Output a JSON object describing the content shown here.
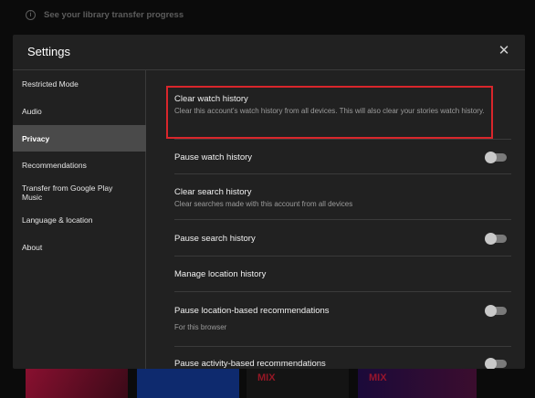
{
  "background": {
    "notice_icon": "info-icon",
    "notice_text": "See your library transfer progress",
    "mix_label": "MIX"
  },
  "dialog": {
    "title": "Settings",
    "close_icon": "close-icon",
    "close_glyph": "✕"
  },
  "sidebar": {
    "items": [
      {
        "label": "Restricted Mode"
      },
      {
        "label": "Audio"
      },
      {
        "label": "Privacy",
        "active": true
      },
      {
        "label": "Recommendations"
      },
      {
        "label": "Transfer from Google Play Music"
      },
      {
        "label": "Language & location"
      },
      {
        "label": "About"
      }
    ]
  },
  "privacy": {
    "clear_watch": {
      "label": "Clear watch history",
      "description": "Clear this account's watch history from all devices. This will also clear your stories watch history."
    },
    "pause_watch": {
      "label": "Pause watch history",
      "enabled": false
    },
    "clear_search": {
      "label": "Clear search history",
      "description": "Clear searches made with this account from all devices"
    },
    "pause_search": {
      "label": "Pause search history",
      "enabled": false
    },
    "manage_location": {
      "label": "Manage location history"
    },
    "pause_location": {
      "label": "Pause location-based recommendations",
      "description": "For this browser",
      "enabled": false
    },
    "pause_activity": {
      "label": "Pause activity-based recommendations",
      "enabled": false
    }
  },
  "colors": {
    "dialog_bg": "#212121",
    "highlight_border": "#d9262b",
    "active_item_bg": "#4a4a4a"
  }
}
